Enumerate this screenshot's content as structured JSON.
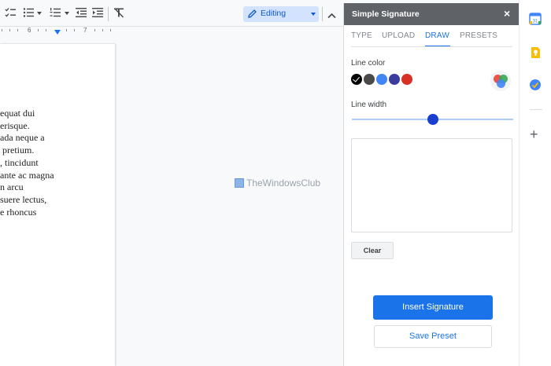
{
  "toolbar": {
    "editing_label": "Editing",
    "icons": [
      "checklist-icon",
      "bulleted-list-icon",
      "numbered-list-icon",
      "decrease-indent-icon",
      "increase-indent-icon",
      "clear-formatting-icon",
      "pencil-icon",
      "chevron-up-icon"
    ]
  },
  "ruler": {
    "numbers": [
      "6",
      "7"
    ]
  },
  "document": {
    "lines": [
      "equat dui",
      "erisque.",
      "ada neque a",
      " pretium.",
      ", tincidunt",
      "ante ac magna",
      "n arcu",
      "suere lectus,",
      "e rhoncus"
    ],
    "watermark": "TheWindowsClub"
  },
  "panel": {
    "title": "Simple Signature",
    "close": "×",
    "tabs": [
      "TYPE",
      "UPLOAD",
      "DRAW",
      "PRESETS"
    ],
    "active_tab": "DRAW",
    "line_color_label": "Line color",
    "line_width_label": "Line width",
    "line_width_value": 0.5,
    "colors": [
      "#000000",
      "#4a4a4a",
      "#4285f4",
      "#3c3c9e",
      "#d93025"
    ],
    "selected_color": "#000000",
    "clear_label": "Clear",
    "insert_label": "Insert Signature",
    "save_preset_label": "Save Preset"
  },
  "sidebar": {
    "icons": [
      "calendar-icon",
      "keep-icon",
      "tasks-icon",
      "add-icon"
    ],
    "calendar_day": "31"
  }
}
